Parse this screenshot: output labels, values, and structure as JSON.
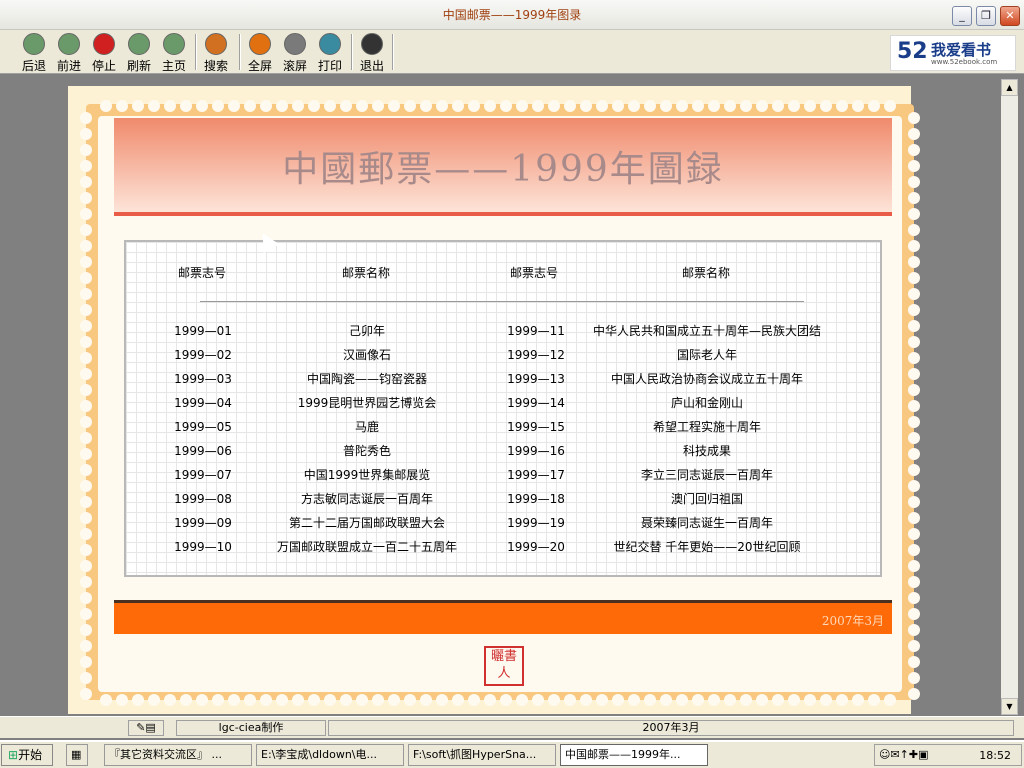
{
  "window": {
    "title": "中国邮票——1999年图录"
  },
  "toolbar": {
    "buttons": [
      {
        "label": "后退",
        "icon": "back-icon",
        "color": "#6a9a6a"
      },
      {
        "label": "前进",
        "icon": "forward-icon",
        "color": "#6a9a6a"
      },
      {
        "label": "停止",
        "icon": "stop-icon",
        "color": "#d02020"
      },
      {
        "label": "刷新",
        "icon": "refresh-icon",
        "color": "#6a9a6a"
      },
      {
        "label": "主页",
        "icon": "home-icon",
        "color": "#6a9a6a"
      },
      {
        "label": "搜索",
        "icon": "search-icon",
        "color": "#d07020"
      },
      {
        "label": "全屏",
        "icon": "fullscreen-icon",
        "color": "#e07010"
      },
      {
        "label": "滚屏",
        "icon": "scroll-icon",
        "color": "#7a7a7a"
      },
      {
        "label": "打印",
        "icon": "print-icon",
        "color": "#3a8aa0"
      },
      {
        "label": "退出",
        "icon": "exit-icon",
        "color": "#333333"
      }
    ]
  },
  "logo": {
    "number": "52",
    "text": "我爱看书",
    "url_text": "www.52ebook.com"
  },
  "content": {
    "heading": "中國郵票——1999年圖録",
    "col_headers": {
      "id": "邮票志号",
      "name": "邮票名称"
    },
    "left_rows": [
      {
        "id": "1999—01",
        "name": "己卯年"
      },
      {
        "id": "1999—02",
        "name": "汉画像石"
      },
      {
        "id": "1999—03",
        "name": "中国陶瓷——钧窑瓷器"
      },
      {
        "id": "1999—04",
        "name": "1999昆明世界园艺博览会"
      },
      {
        "id": "1999—05",
        "name": "马鹿"
      },
      {
        "id": "1999—06",
        "name": "普陀秀色"
      },
      {
        "id": "1999—07",
        "name": "中国1999世界集邮展览"
      },
      {
        "id": "1999—08",
        "name": "方志敏同志诞辰一百周年"
      },
      {
        "id": "1999—09",
        "name": "第二十二届万国邮政联盟大会"
      },
      {
        "id": "1999—10",
        "name": "万国邮政联盟成立一百二十五周年"
      }
    ],
    "right_rows": [
      {
        "id": "1999—11",
        "name": "中华人民共和国成立五十周年—民族大团结"
      },
      {
        "id": "1999—12",
        "name": "国际老人年"
      },
      {
        "id": "1999—13",
        "name": "中国人民政治协商会议成立五十周年"
      },
      {
        "id": "1999—14",
        "name": "庐山和金刚山"
      },
      {
        "id": "1999—15",
        "name": "希望工程实施十周年"
      },
      {
        "id": "1999—16",
        "name": "科技成果"
      },
      {
        "id": "1999—17",
        "name": "李立三同志诞辰一百周年"
      },
      {
        "id": "1999—18",
        "name": "澳门回归祖国"
      },
      {
        "id": "1999—19",
        "name": "聂荣臻同志诞生一百周年"
      },
      {
        "id": "1999—20",
        "name": "世纪交替 千年更始——20世纪回顾"
      }
    ],
    "footer_date": "2007年3月",
    "seal_text": "曬書人"
  },
  "statusbar": {
    "author": "lgc-ciea制作",
    "date": "2007年3月"
  },
  "taskbar": {
    "start": "开始",
    "tasks": [
      "『其它资料交流区』 ...",
      "E:\\李宝成\\dldown\\电...",
      "F:\\soft\\抓图HyperSna...",
      "中国邮票——1999年..."
    ],
    "clock": "18:52"
  }
}
